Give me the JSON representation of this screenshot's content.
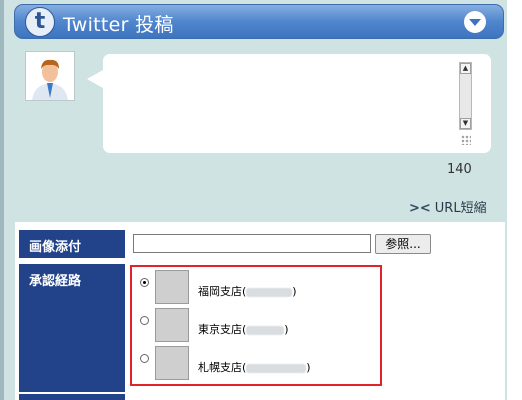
{
  "header": {
    "logo_letter": "t",
    "title": "Twitter 投稿"
  },
  "compose": {
    "counter": "140",
    "url_shorten_label": "URL短縮"
  },
  "form": {
    "image_attach_label": "画像添付",
    "browse_label": "参照...",
    "approval_label": "承認経路",
    "branches": [
      {
        "name": "福岡支店(",
        "suffix": ")",
        "selected": true
      },
      {
        "name": "東京支店(",
        "suffix": ")",
        "selected": false
      },
      {
        "name": "札幌支店(",
        "suffix": ")",
        "selected": false
      }
    ]
  }
}
